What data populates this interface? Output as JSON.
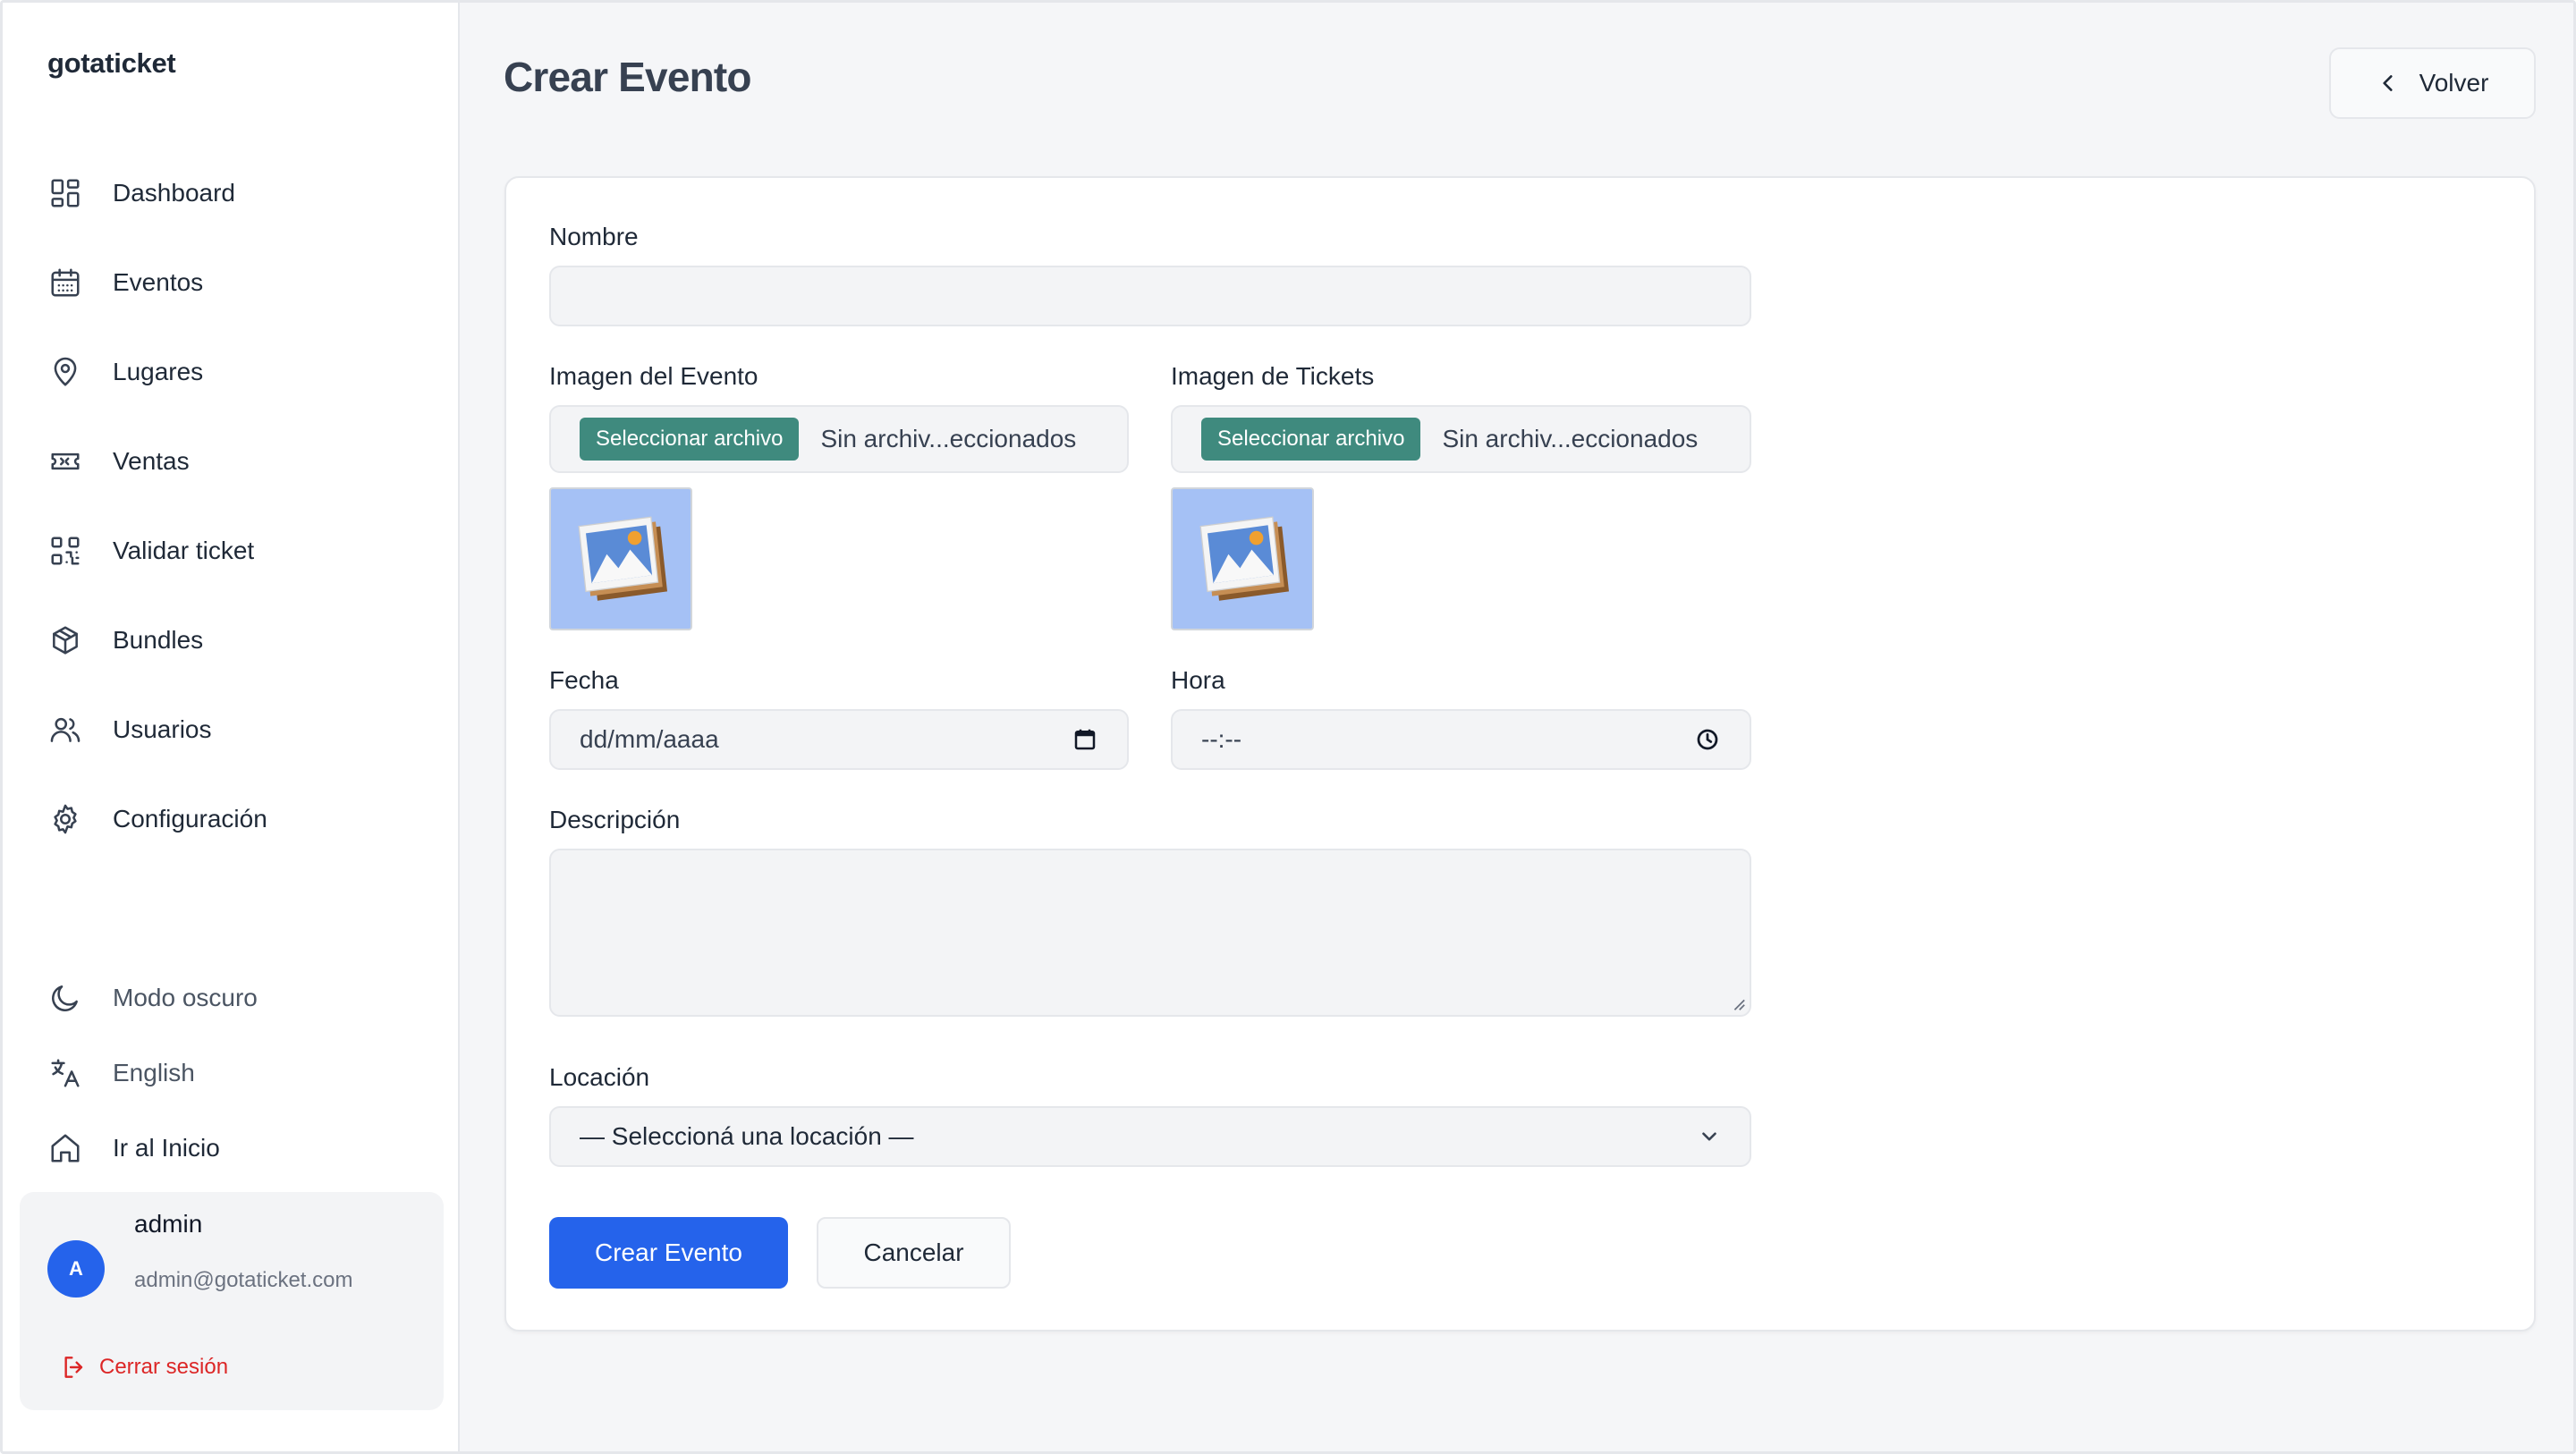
{
  "app": {
    "brand": "gotaticket"
  },
  "sidebar": {
    "items": [
      {
        "label": "Dashboard",
        "icon": "dashboard-icon"
      },
      {
        "label": "Eventos",
        "icon": "calendar-icon"
      },
      {
        "label": "Lugares",
        "icon": "map-pin-icon"
      },
      {
        "label": "Ventas",
        "icon": "ticket-icon"
      },
      {
        "label": "Validar ticket",
        "icon": "qr-code-icon"
      },
      {
        "label": "Bundles",
        "icon": "package-icon"
      },
      {
        "label": "Usuarios",
        "icon": "users-icon"
      },
      {
        "label": "Configuración",
        "icon": "settings-icon"
      }
    ],
    "bottom": [
      {
        "label": "Modo oscuro",
        "icon": "moon-icon"
      },
      {
        "label": "English",
        "icon": "translate-icon"
      },
      {
        "label": "Ir al Inicio",
        "icon": "home-icon"
      }
    ],
    "user": {
      "initial": "A",
      "name": "admin",
      "email": "admin@gotaticket.com",
      "logout_label": "Cerrar sesión"
    }
  },
  "header": {
    "title": "Crear Evento",
    "back_label": "Volver"
  },
  "form": {
    "name": {
      "label": "Nombre",
      "value": ""
    },
    "event_image": {
      "label": "Imagen del Evento",
      "button": "Seleccionar archivo",
      "status": "Sin archiv...eccionados"
    },
    "ticket_image": {
      "label": "Imagen de Tickets",
      "button": "Seleccionar archivo",
      "status": "Sin archiv...eccionados"
    },
    "date": {
      "label": "Fecha",
      "placeholder": "dd/mm/aaaa"
    },
    "time": {
      "label": "Hora",
      "placeholder": "--:--"
    },
    "description": {
      "label": "Descripción",
      "value": ""
    },
    "location": {
      "label": "Locación",
      "selected": "— Seleccioná una locación —"
    },
    "submit_label": "Crear Evento",
    "cancel_label": "Cancelar"
  },
  "colors": {
    "accent": "#2563eb",
    "file_button": "#3f8a7e",
    "logout": "#dc2626",
    "thumb_bg": "#a5c1f5"
  }
}
